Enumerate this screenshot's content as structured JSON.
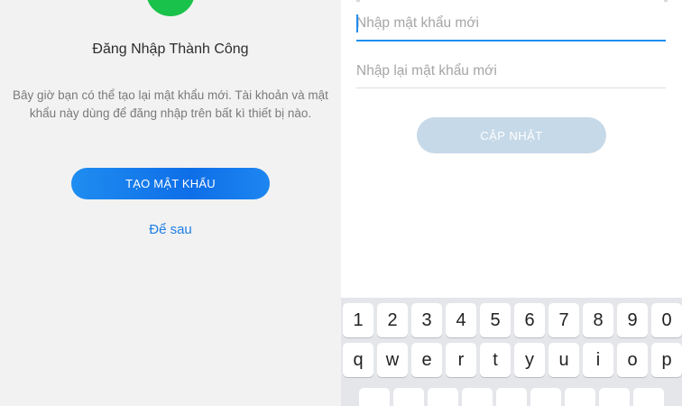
{
  "left": {
    "title": "Đăng Nhập Thành Công",
    "description": "Bây giờ bạn có thể tạo lại mật khẩu mới. Tài khoản và mật khẩu này dùng để đăng nhập trên bất kì thiết bị nào.",
    "create_password_button": "TẠO MẬT KHẨU",
    "later_link": "Để sau",
    "success_icon": "success-check-circle-icon",
    "accent_color": "#1f8df0",
    "success_color": "#19c24a"
  },
  "right": {
    "new_password_placeholder": "Nhập mật khẩu mới",
    "confirm_password_placeholder": "Nhập lại mật khẩu mới",
    "update_button": "CẬP NHẬT",
    "update_button_state": "disabled"
  },
  "keyboard": {
    "digits": [
      "1",
      "2",
      "3",
      "4",
      "5",
      "6",
      "7",
      "8",
      "9",
      "0"
    ],
    "letters": [
      "q",
      "w",
      "e",
      "r",
      "t",
      "y",
      "u",
      "i",
      "o",
      "p"
    ]
  }
}
